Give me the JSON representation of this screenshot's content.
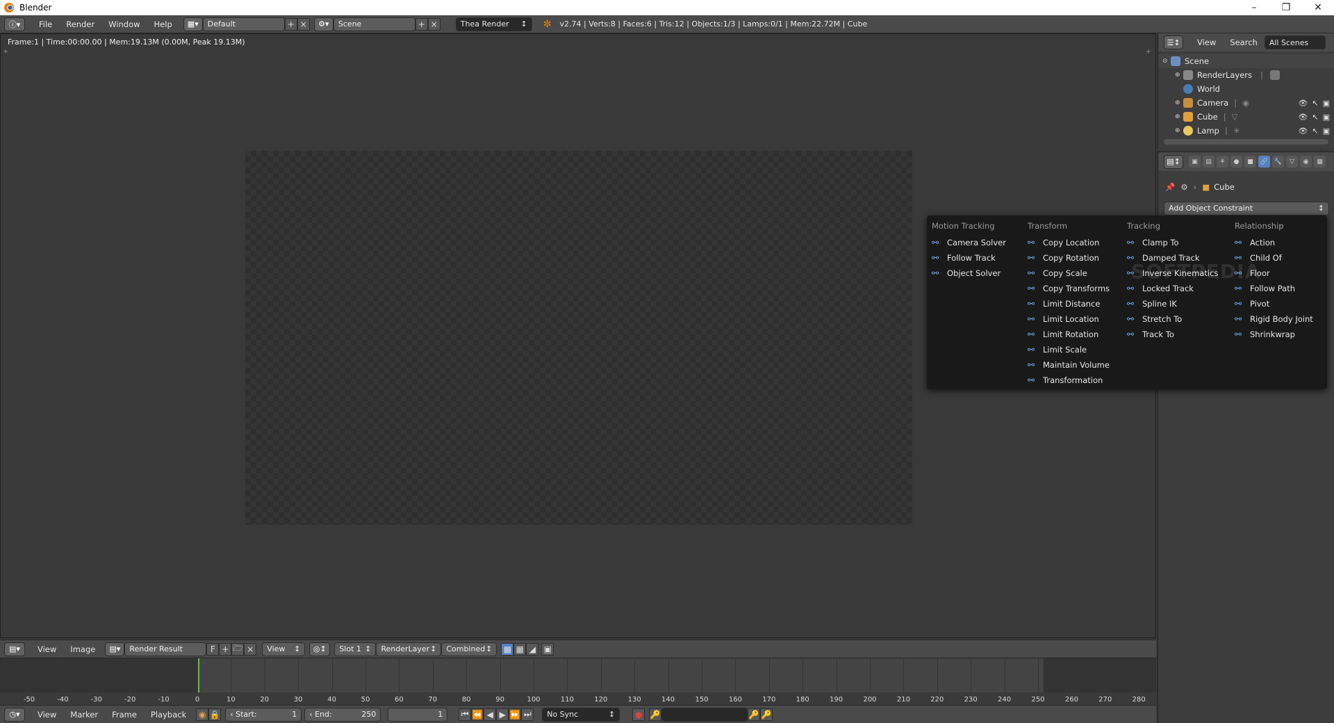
{
  "window": {
    "title": "Blender"
  },
  "info_header": {
    "menus": [
      "File",
      "Render",
      "Window",
      "Help"
    ],
    "layout": "Default",
    "scene": "Scene",
    "engine": "Thea Render",
    "stats": "v2.74 | Verts:8 | Faces:6 | Tris:12 | Objects:1/3 | Lamps:0/1 | Mem:22.72M | Cube"
  },
  "editor": {
    "frame_info": "Frame:1 | Time:00:00.00 | Mem:19.13M (0.00M, Peak 19.13M)"
  },
  "image_header": {
    "view": "View",
    "image": "Image",
    "image_name": "Render Result",
    "f_label": "F",
    "view_mode": "View",
    "slot": "Slot 1",
    "layer": "RenderLayer",
    "pass": "Combined"
  },
  "timeline": {
    "ticks": [
      "-50",
      "-40",
      "-30",
      "-20",
      "-10",
      "0",
      "10",
      "20",
      "30",
      "40",
      "50",
      "60",
      "70",
      "80",
      "90",
      "100",
      "110",
      "120",
      "130",
      "140",
      "150",
      "160",
      "170",
      "180",
      "190",
      "200",
      "210",
      "220",
      "230",
      "240",
      "250",
      "260",
      "270",
      "280"
    ],
    "menus": [
      "View",
      "Marker",
      "Frame",
      "Playback"
    ],
    "start_label": "Start:",
    "start": "1",
    "end_label": "End:",
    "end": "250",
    "current": "1",
    "sync": "No Sync"
  },
  "outliner": {
    "header": {
      "view": "View",
      "search": "Search",
      "filter": "All Scenes"
    },
    "items": [
      {
        "label": "Scene",
        "color": "#6d8fc0"
      },
      {
        "label": "RenderLayers",
        "color": "#888888"
      },
      {
        "label": "World",
        "color": "#4a7bb5"
      },
      {
        "label": "Camera",
        "color": "#c88c3c"
      },
      {
        "label": "Cube",
        "color": "#e0a040"
      },
      {
        "label": "Lamp",
        "color": "#e8c860"
      }
    ]
  },
  "properties": {
    "object": "Cube",
    "add_constraint": "Add Object Constraint"
  },
  "constraint_menu": {
    "columns": [
      {
        "title": "Motion Tracking",
        "items": [
          "Camera Solver",
          "Follow Track",
          "Object Solver"
        ]
      },
      {
        "title": "Transform",
        "items": [
          "Copy Location",
          "Copy Rotation",
          "Copy Scale",
          "Copy Transforms",
          "Limit Distance",
          "Limit Location",
          "Limit Rotation",
          "Limit Scale",
          "Maintain Volume",
          "Transformation"
        ]
      },
      {
        "title": "Tracking",
        "items": [
          "Clamp To",
          "Damped Track",
          "Inverse Kinematics",
          "Locked Track",
          "Spline IK",
          "Stretch To",
          "Track To"
        ]
      },
      {
        "title": "Relationship",
        "items": [
          "Action",
          "Child Of",
          "Floor",
          "Follow Path",
          "Pivot",
          "Rigid Body Joint",
          "Shrinkwrap"
        ]
      }
    ]
  },
  "watermark": "SOFTPEDIA",
  "colors": {
    "accent": "#5680c2",
    "link_icon": "#7ab0ff",
    "frame_cursor": "#60c040"
  }
}
